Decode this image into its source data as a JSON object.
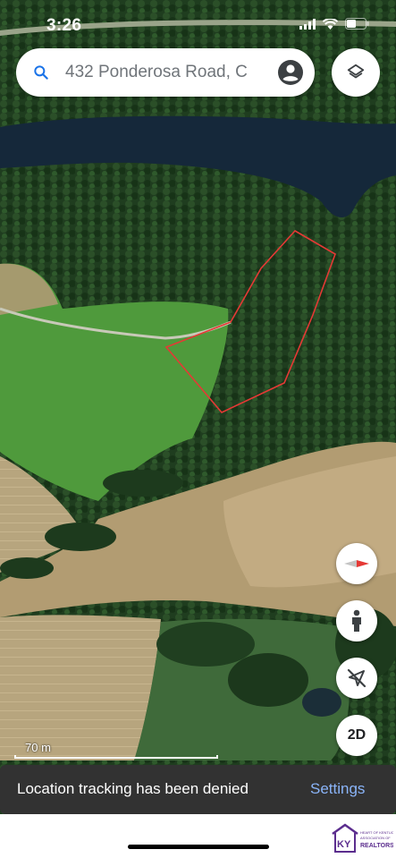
{
  "status_bar": {
    "time": "3:26"
  },
  "search": {
    "text": "432 Ponderosa Road, C"
  },
  "icons": {
    "search": "search-icon",
    "account": "account-circle-icon",
    "layers": "layers-icon",
    "compass": "compass-icon",
    "pegman": "street-view-pegman-icon",
    "location": "location-disabled-icon"
  },
  "map_controls": {
    "view_mode_label": "2D"
  },
  "scale": {
    "label": "70 m"
  },
  "snackbar": {
    "message": "Location tracking has been denied",
    "action": "Settings"
  },
  "logo": {
    "brand_line1": "HEART OF KENTUCKY",
    "brand_line2": "ASSOCIATION OF",
    "brand_line3": "REALTORS",
    "initials": "KY"
  },
  "colors": {
    "boundary": "#e53935",
    "accent": "#1a73e8",
    "snackbar_action": "#8ab4f8"
  }
}
